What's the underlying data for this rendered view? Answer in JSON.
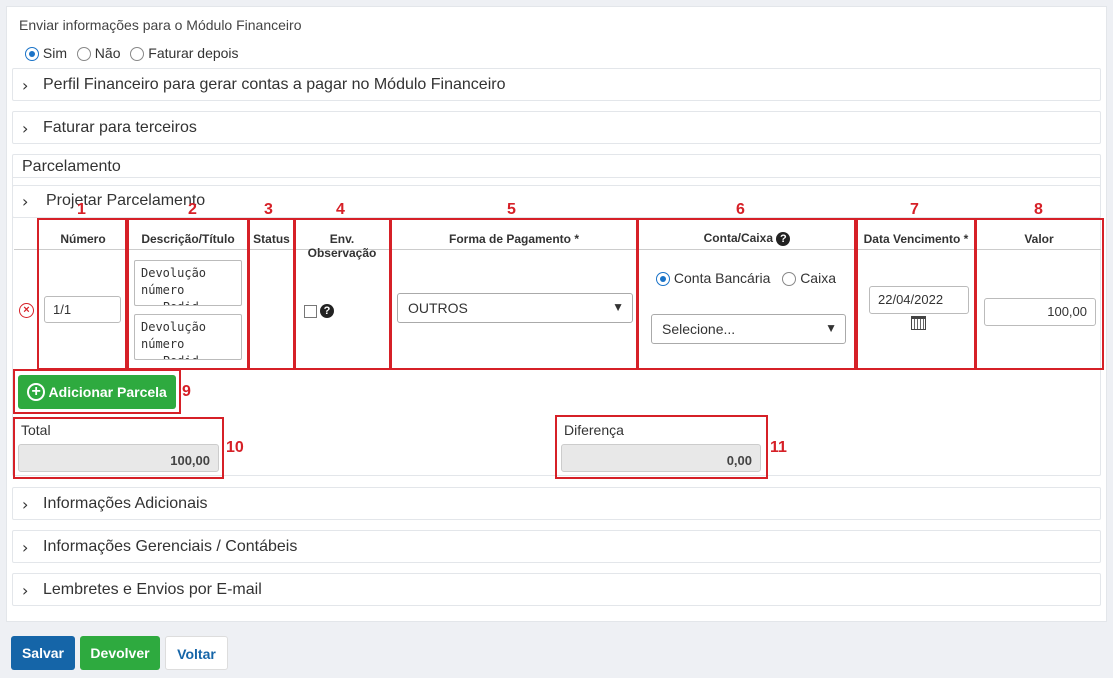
{
  "financeiro": {
    "title": "Enviar informações para o Módulo Financeiro",
    "options": [
      "Sim",
      "Não",
      "Faturar depois"
    ],
    "selected": "Sim"
  },
  "accordions_top": [
    "Perfil Financeiro para gerar contas a pagar no Módulo Financeiro",
    "Faturar para terceiros"
  ],
  "parcelamento": {
    "title": "Parcelamento",
    "projetar": "Projetar Parcelamento",
    "headers": {
      "numero": "Número",
      "descricao": "Descrição/Título",
      "status": "Status",
      "env_obs": "Env. Observação",
      "forma_pagamento": "Forma de Pagamento *",
      "conta_caixa": "Conta/Caixa",
      "data_vencimento": "Data Vencimento *",
      "valor": "Valor"
    },
    "row": {
      "numero": "1/1",
      "descricao_1": "Devolução\nnúmero\n   Pedid",
      "descricao_2": "Devolução\nnúmero\n   Pedid",
      "forma_pagamento": "OUTROS",
      "conta_options": [
        "Conta Bancária",
        "Caixa"
      ],
      "conta_selected": "Conta Bancária",
      "conta_select_placeholder": "Selecione...",
      "data_vencimento": "22/04/2022",
      "valor": "100,00"
    },
    "add_button": "Adicionar Parcela",
    "total_label": "Total",
    "total_value": "100,00",
    "diferenca_label": "Diferença",
    "diferenca_value": "0,00"
  },
  "annotations": [
    "1",
    "2",
    "3",
    "4",
    "5",
    "6",
    "7",
    "8",
    "9",
    "10",
    "11"
  ],
  "accordions_bottom": [
    "Informações Adicionais",
    "Informações Gerenciais / Contábeis",
    "Lembretes e Envios por E-mail"
  ],
  "footer": {
    "salvar": "Salvar",
    "devolver": "Devolver",
    "voltar": "Voltar"
  },
  "colors": {
    "primary": "#1565a8",
    "success": "#2eaa3f",
    "annotation": "#d62027",
    "remove": "#d62027"
  }
}
